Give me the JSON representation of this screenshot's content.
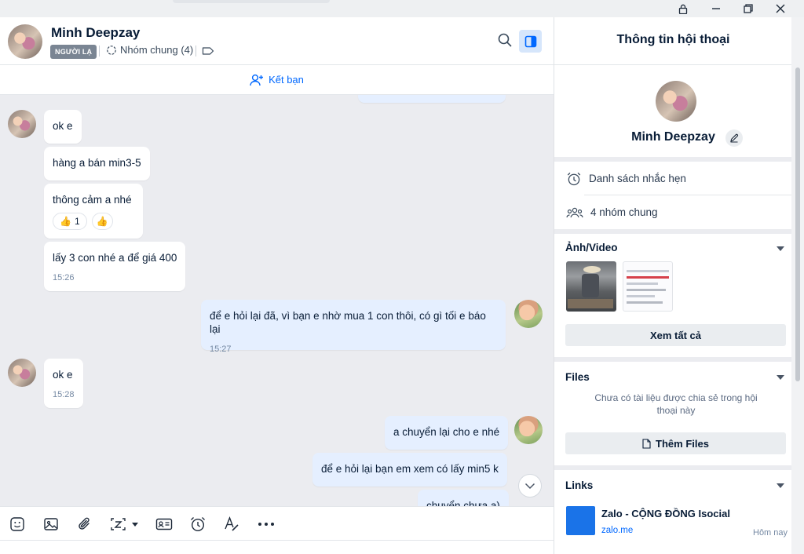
{
  "window": {
    "controls": [
      "lock-icon",
      "minimize-icon",
      "restore-icon",
      "close-icon"
    ]
  },
  "chat_header": {
    "name": "Minh Deepzay",
    "badge": "NGƯỜI LẠ",
    "groups_label": "Nhóm chung (4)"
  },
  "friend_bar": {
    "label": "Kết bạn"
  },
  "messages": [
    {
      "dir": "in",
      "text": "ok e",
      "time": ""
    },
    {
      "dir": "in",
      "text": "hàng a bán min3-5",
      "time": ""
    },
    {
      "dir": "in",
      "text": "thông cảm a nhé",
      "time": "",
      "reactions": [
        {
          "emoji": "👍",
          "count": "1"
        },
        {
          "emoji": "👍",
          "count": ""
        }
      ]
    },
    {
      "dir": "in",
      "text": "lấy 3 con nhé a để giá 400",
      "time": "15:26"
    },
    {
      "dir": "out",
      "text": "để e hỏi lại đã, vì bạn e nhờ mua 1 con thôi, có gì tối e báo lại",
      "time": "15:27"
    },
    {
      "dir": "in",
      "text": "ok e",
      "time": "15:28"
    },
    {
      "dir": "out",
      "text": "a chuyển lại cho e nhé",
      "time": ""
    },
    {
      "dir": "out",
      "text": "để e hỏi lại bạn em xem có lấy min5 k",
      "time": ""
    },
    {
      "dir": "out",
      "text": "chuyển chưa a)",
      "time": ""
    }
  ],
  "toolbar": {
    "tools": [
      "sticker-icon",
      "image-icon",
      "attach-icon",
      "screenshot-icon",
      "contact-card-icon",
      "reminder-icon",
      "format-text-icon",
      "more-icon"
    ]
  },
  "info": {
    "title": "Thông tin hội thoại",
    "name": "Minh Deepzay",
    "reminders_label": "Danh sách nhắc hẹn",
    "common_groups_label": "4 nhóm chung",
    "media": {
      "title": "Ảnh/Video",
      "see_all": "Xem tất cả"
    },
    "files": {
      "title": "Files",
      "empty_text": "Chưa có tài liệu được chia sẻ trong hội thoại này",
      "add_button": "Thêm Files"
    },
    "links": {
      "title": "Links",
      "items": [
        {
          "title": "Zalo - CỘNG ĐỒNG Isocial",
          "domain": "zalo.me",
          "time": "Hôm nay"
        }
      ]
    }
  },
  "colors": {
    "accent": "#0068ff",
    "outgoing_bubble": "#e5efff",
    "chat_bg": "#ebecf0"
  }
}
